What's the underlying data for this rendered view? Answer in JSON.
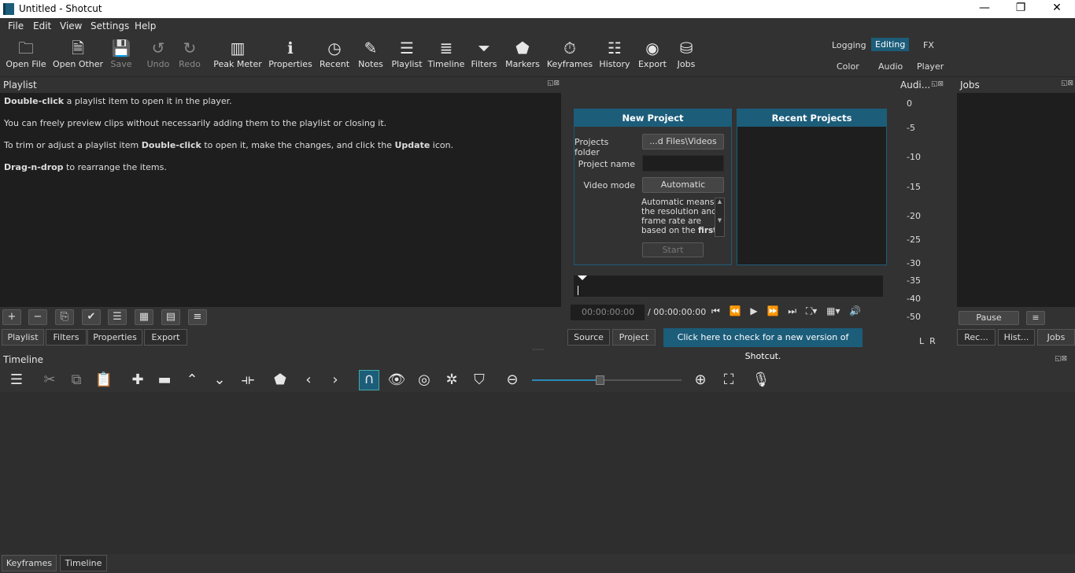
{
  "window": {
    "title": "Untitled - Shotcut",
    "minimize": "—",
    "maximize": "❐",
    "close": "✕"
  },
  "menu": [
    "File",
    "Edit",
    "View",
    "Settings",
    "Help"
  ],
  "toolbar": [
    {
      "label": "Open File",
      "icon": "folder-icon",
      "glyph": "🗀",
      "enabled": true
    },
    {
      "label": "Open Other",
      "icon": "open-other-icon",
      "glyph": "🗎",
      "enabled": true
    },
    {
      "label": "Save",
      "icon": "save-icon",
      "glyph": "💾",
      "enabled": false
    },
    {
      "label": "Undo",
      "icon": "undo-icon",
      "glyph": "↺",
      "enabled": false
    },
    {
      "label": "Redo",
      "icon": "redo-icon",
      "glyph": "↻",
      "enabled": false
    },
    {
      "label": "Peak Meter",
      "icon": "peak-meter-icon",
      "glyph": "▥",
      "enabled": true
    },
    {
      "label": "Properties",
      "icon": "info-icon",
      "glyph": "ℹ",
      "enabled": true
    },
    {
      "label": "Recent",
      "icon": "clock-icon",
      "glyph": "◷",
      "enabled": true
    },
    {
      "label": "Notes",
      "icon": "notes-icon",
      "glyph": "✎",
      "enabled": true
    },
    {
      "label": "Playlist",
      "icon": "list-icon",
      "glyph": "☰",
      "enabled": true
    },
    {
      "label": "Timeline",
      "icon": "timeline-icon",
      "glyph": "≣",
      "enabled": true
    },
    {
      "label": "Filters",
      "icon": "filter-icon",
      "glyph": "⏷",
      "enabled": true
    },
    {
      "label": "Markers",
      "icon": "marker-icon",
      "glyph": "⬟",
      "enabled": true
    },
    {
      "label": "Keyframes",
      "icon": "stopwatch-icon",
      "glyph": "⏱",
      "enabled": true
    },
    {
      "label": "History",
      "icon": "history-icon",
      "glyph": "☷",
      "enabled": true
    },
    {
      "label": "Export",
      "icon": "export-icon",
      "glyph": "◉",
      "enabled": true
    },
    {
      "label": "Jobs",
      "icon": "jobs-icon",
      "glyph": "⛁",
      "enabled": true
    }
  ],
  "workspaces": {
    "top": [
      "Logging",
      "Editing",
      "FX"
    ],
    "bottom": [
      "Color",
      "Audio",
      "Player"
    ],
    "active": "Editing"
  },
  "playlist": {
    "title": "Playlist",
    "help": [
      {
        "b": "Double-click",
        "t": " a playlist item to open it in the player."
      },
      {
        "b": "",
        "t": "You can freely preview clips without necessarily adding them to the playlist or closing it."
      },
      {
        "b": "",
        "t": "To trim or adjust a playlist item ",
        "b2": "Double-click",
        "t2": " to open it, make the changes, and click the ",
        "b3": "Update",
        "t3": " icon."
      },
      {
        "b": "Drag-n-drop",
        "t": " to rearrange the items."
      }
    ],
    "buttons": [
      "+",
      "−",
      "⎘",
      "✔",
      "☰",
      "▦",
      "▤",
      "≡"
    ],
    "tabs": [
      "Playlist",
      "Filters",
      "Properties",
      "Export"
    ]
  },
  "player": {
    "new_project": {
      "title": "New Project",
      "folder_label": "Projects folder",
      "folder_value": "...d Files\\Videos",
      "name_label": "Project name",
      "name_value": "",
      "mode_label": "Video mode",
      "mode_value": "Automatic",
      "desc1": "Automatic means",
      "desc2": "the resolution and",
      "desc3": "frame rate are",
      "desc4": "based on the ",
      "desc_bold": "first",
      "start": "Start"
    },
    "recent_projects": {
      "title": "Recent Projects"
    },
    "timecode": "00:00:00:00",
    "duration": "/ 00:00:00:00",
    "tabs": [
      "Source",
      "Project"
    ],
    "update_notice": "Click here to check for a new version of Shotcut."
  },
  "audio": {
    "title": "Audi...",
    "scale": [
      "0",
      "-5",
      "-10",
      "-15",
      "-20",
      "-25",
      "-30",
      "-35",
      "-40",
      "-50"
    ],
    "channels": "L  R"
  },
  "jobs": {
    "title": "Jobs",
    "pause": "Pause",
    "menu": "≡",
    "tabs": [
      "Rec...",
      "Hist...",
      "Jobs"
    ]
  },
  "timeline": {
    "title": "Timeline",
    "tabs": [
      "Keyframes",
      "Timeline"
    ],
    "zoom_level": 0.45,
    "accent": "#1c5d7a"
  }
}
